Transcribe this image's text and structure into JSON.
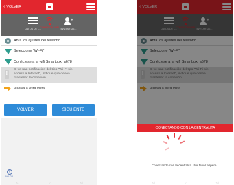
{
  "header": {
    "back_label": "VOLVER"
  },
  "steps": [
    {
      "label": "DATOS DE L...",
      "icon": "list-icon"
    },
    {
      "label": "CONEXIÓN WIFI",
      "icon": "wifi-icon"
    },
    {
      "label": "INVITAR US...",
      "icon": "add-user-icon"
    }
  ],
  "instructions": {
    "item1": "Abra los ajustes del teléfono",
    "item2": "Seleccione \"Wi-Fi\"",
    "item3": "Conéctese a la wifi Smartbox_a678",
    "notice_line1": "Si ve una notificación del tipo \"Wi-Fi sin",
    "notice_line2": "access a Internet\", indique que desea",
    "notice_line3": "mantener la conexión",
    "item4": "Vuelva a esta vista"
  },
  "buttons": {
    "back": "VOLVER",
    "next": "SIGUIENTE"
  },
  "help": {
    "label": "AYUDA"
  },
  "navbar": {
    "back": "◁",
    "home": "○",
    "recent": "◁"
  },
  "connecting": {
    "bar_label": "CONECTANDO CON LA CENTRALITA",
    "message": "Conectando con la centralita. Por favor espere..."
  },
  "colors": {
    "brand_red": "#e2262e",
    "button_blue": "#2e8bd8",
    "step_bg": "#646464"
  }
}
